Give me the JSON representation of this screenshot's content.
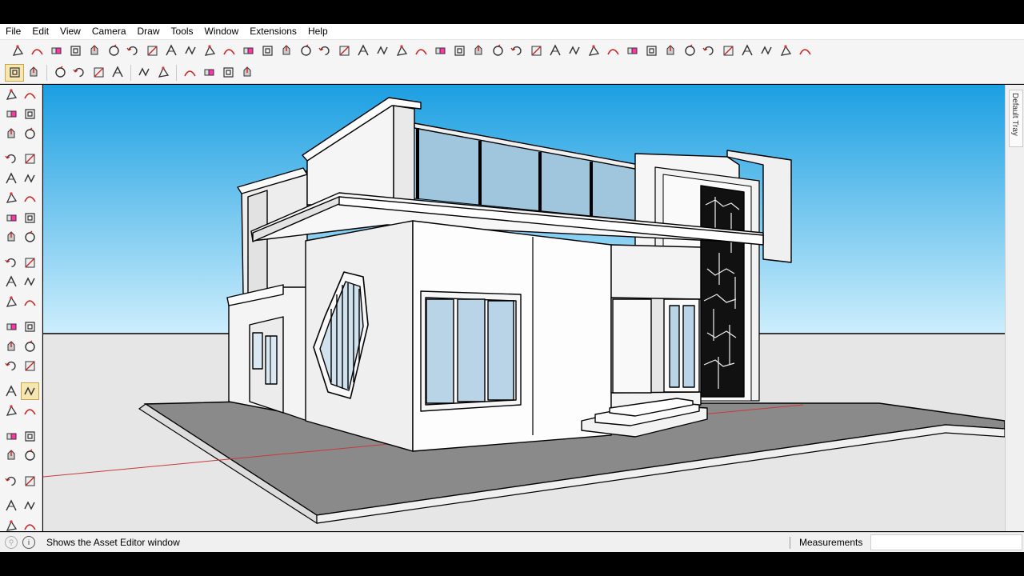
{
  "menu": [
    "File",
    "Edit",
    "View",
    "Camera",
    "Draw",
    "Tools",
    "Window",
    "Extensions",
    "Help"
  ],
  "toolbar1_icons": [
    "move-icon",
    "arc-icon",
    "eraser-icon",
    "offset-icon",
    "push-pull-icon",
    "follow-me-icon",
    "rotate-icon",
    "scale-icon",
    "shape-bones-icon",
    "soap-skin-icon",
    "fredo-scale-icon",
    "fillet-icon",
    "chamfer-icon",
    "line-icon",
    "curve-icon",
    "box-icon",
    "round-corner-icon",
    "bezier-icon",
    "flowify-icon",
    "joint-push-pull-icon",
    "vertex-tools-icon",
    "curviloft-icon",
    "extrude-icon",
    "tools-on-surface-icon",
    "profile-builder-icon",
    "split-icon",
    "weld-icon",
    "subdivide-icon",
    "array-icon",
    "path-copy-icon",
    "stair-icon",
    "roof-icon",
    "wall-icon",
    "window-tool-icon",
    "door-tool-icon",
    "fence-icon",
    "cleanup-icon",
    "sweep-icon",
    "loft-icon",
    "twist-icon",
    "hatch-icon",
    "dimension-icon"
  ],
  "toolbar2_icons": [
    "asset-editor-icon",
    "component-options-icon",
    "orbit-icon",
    "pan-icon",
    "zoom-icon",
    "rotate-view-icon",
    "section-plane-icon",
    "section-display-icon",
    "top-view-icon",
    "front-view-icon",
    "side-view-icon",
    "lock-view-icon"
  ],
  "left_tools": [
    [
      "select-icon",
      "orbit-tool-icon"
    ],
    [
      "paint-bucket-icon",
      "eraser-tool-icon"
    ],
    [
      "component-icon",
      "pencil-icon"
    ],
    [
      "line-tool-icon",
      "freehand-icon"
    ],
    [
      "rectangle-icon",
      "rotated-rectangle-icon"
    ],
    [
      "circle-icon",
      "polygon-icon"
    ],
    [
      "arc-tool-icon",
      "two-point-arc-icon"
    ],
    [
      "pie-icon",
      "three-point-arc-icon"
    ],
    [
      "move-tool-icon",
      "push-pull-tool-icon"
    ],
    [
      "rotate-tool-icon",
      "follow-me-tool-icon"
    ],
    [
      "scale-tool-icon",
      "offset-tool-icon"
    ],
    [
      "tape-measure-icon",
      "dimension-tool-icon"
    ],
    [
      "protractor-icon",
      "text-icon"
    ],
    [
      "axes-icon",
      "3d-text-icon"
    ],
    [
      "orbit-nav-icon",
      "pan-nav-icon"
    ],
    [
      "zoom-nav-icon",
      "zoom-window-icon"
    ],
    [
      "zoom-extents-icon",
      "previous-view-icon"
    ],
    [
      "position-camera-icon",
      "look-around-icon"
    ],
    [
      "walk-icon",
      "section-tool-icon"
    ],
    [
      "sandbox-icon",
      "smoove-icon"
    ],
    [
      "stamp-icon",
      "drape-icon"
    ]
  ],
  "tray": {
    "label": "Default Tray"
  },
  "status": {
    "message": "Shows the Asset Editor window",
    "measurements_label": "Measurements",
    "measurements_value": ""
  },
  "colors": {
    "sky_top": "#1b9fe2",
    "sky_bottom": "#c8ecfb",
    "ground": "#8a8a8a",
    "wall": "#f0f0f0",
    "glass": "#a9cce0",
    "red_axis": "#c83a3a"
  }
}
